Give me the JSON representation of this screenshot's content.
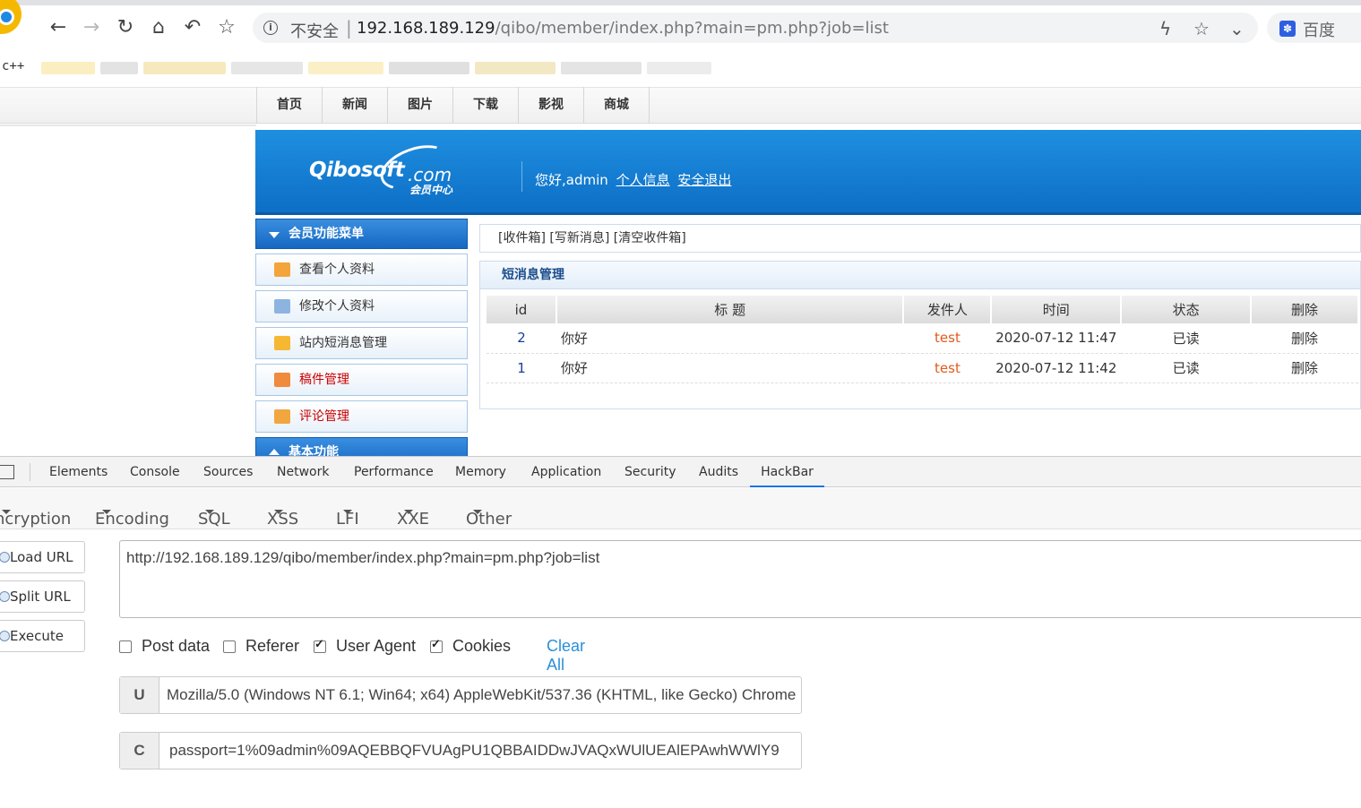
{
  "browser": {
    "url_insecure_label": "不安全",
    "url_separator": "|",
    "url_host": "192.168.189.129",
    "url_path": "/qibo/member/index.php?main=pm.php?job=list",
    "search_engine_label": "百度",
    "bookmark_first": "c++"
  },
  "site": {
    "nav": [
      "首页",
      "新闻",
      "图片",
      "下载",
      "影视",
      "商城"
    ],
    "logo_main": "Qibosoft",
    "logo_dot": ".com",
    "logo_sub": "会员中心",
    "greeting": "您好,admin",
    "profile_link": "个人信息",
    "logout_link": "安全退出",
    "sidebar_header": "会员功能菜单",
    "sidebar_items": [
      "查看个人资料",
      "修改个人资料",
      "站内短消息管理",
      "稿件管理",
      "评论管理"
    ],
    "sidebar_footer": "基本功能",
    "toplinks": "[收件箱] [写新消息] [清空收件箱]",
    "panel_title": "短消息管理",
    "table_headers": [
      "id",
      "标 题",
      "发件人",
      "时间",
      "状态",
      "删除"
    ],
    "rows": [
      {
        "id": "2",
        "title": "你好",
        "from": "test",
        "time": "2020-07-12 11:47",
        "status": "已读",
        "delete": "删除"
      },
      {
        "id": "1",
        "title": "你好",
        "from": "test",
        "time": "2020-07-12 11:42",
        "status": "已读",
        "delete": "删除"
      }
    ]
  },
  "devtools": {
    "tabs": [
      "Elements",
      "Console",
      "Sources",
      "Network",
      "Performance",
      "Memory",
      "Application",
      "Security",
      "Audits",
      "HackBar"
    ],
    "active_tab": "HackBar",
    "hackbar_menus": [
      "ncryption",
      "Encoding",
      "SQL",
      "XSS",
      "LFI",
      "XXE",
      "Other"
    ],
    "buttons": [
      "Load URL",
      "Split URL",
      "Execute"
    ],
    "url_value": "http://192.168.189.129/qibo/member/index.php?main=pm.php?job=list",
    "options": [
      {
        "label": "Post data",
        "checked": false
      },
      {
        "label": "Referer",
        "checked": false
      },
      {
        "label": "User Agent",
        "checked": true
      },
      {
        "label": "Cookies",
        "checked": true
      }
    ],
    "clear_all": "Clear All",
    "ua_key": "U",
    "ua_value": "Mozilla/5.0 (Windows NT 6.1; Win64; x64) AppleWebKit/537.36 (KHTML, like Gecko) Chrome",
    "cookie_key": "C",
    "cookie_value": "passport=1%09admin%09AQEBBQFVUAgPU1QBBAIDDwJVAQxWUlUEAlEPAwhWWlY9"
  }
}
